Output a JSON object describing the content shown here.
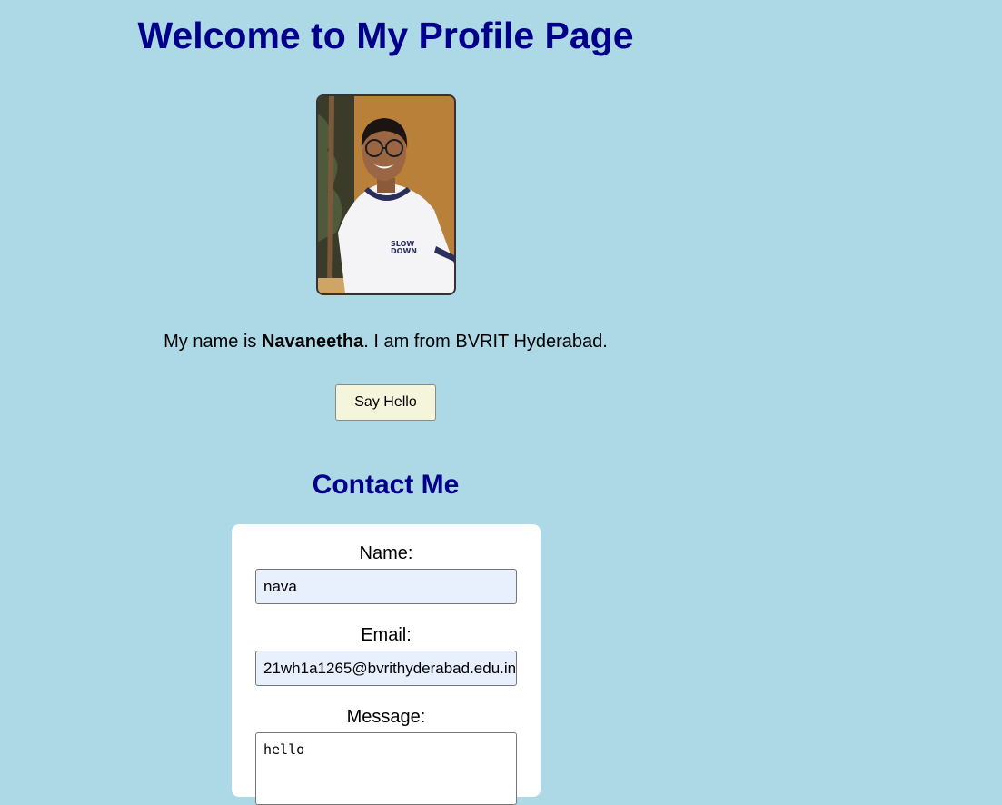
{
  "page": {
    "title": "Welcome to My Profile Page",
    "intro": {
      "prefix": "My name is ",
      "name": "Navaneetha",
      "suffix": ". I am from BVRIT Hyderabad."
    },
    "say_hello_label": "Say Hello"
  },
  "contact": {
    "heading": "Contact Me",
    "name_label": "Name:",
    "name_value": "nava",
    "email_label": "Email:",
    "email_value": "21wh1a1265@bvrithyderabad.edu.in",
    "message_label": "Message:",
    "message_value": "hello"
  },
  "colors": {
    "background": "#add8e6",
    "heading": "#00008b",
    "button": "#f5f5dc",
    "autofill": "#e8f0fe"
  }
}
